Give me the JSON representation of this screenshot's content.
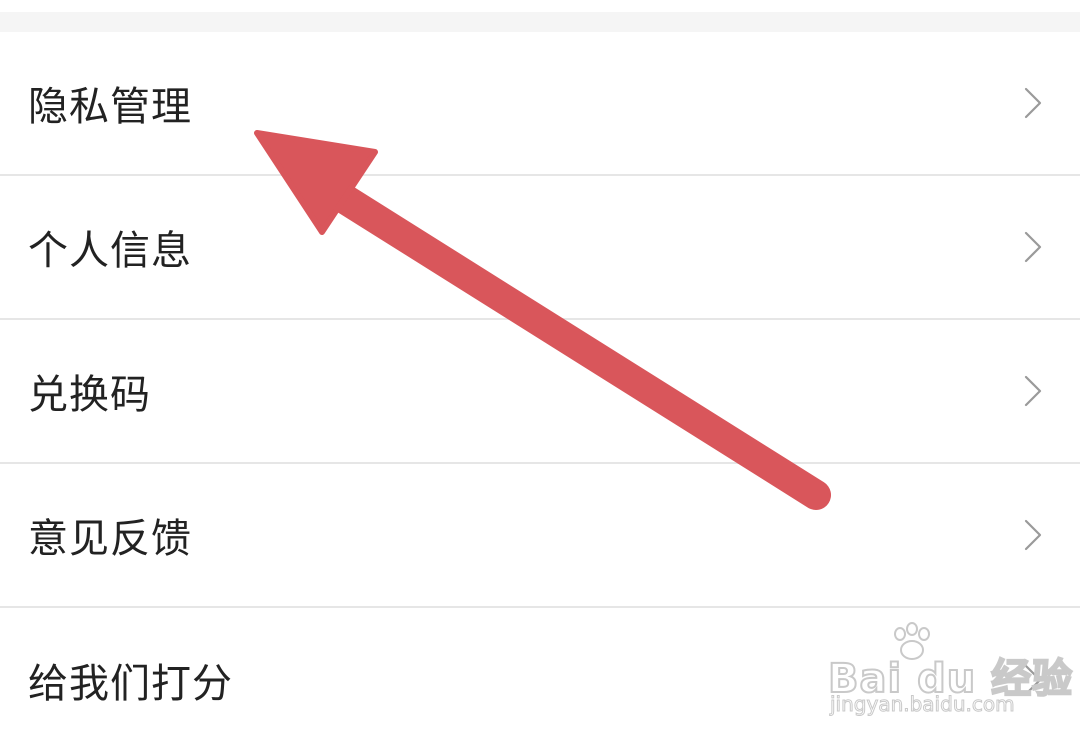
{
  "menu": {
    "items": [
      {
        "label": "隐私管理"
      },
      {
        "label": "个人信息"
      },
      {
        "label": "兑换码"
      },
      {
        "label": "意见反馈"
      },
      {
        "label": "给我们打分"
      }
    ]
  },
  "icons": {
    "chevron": "chevron-right-icon",
    "annotation": "annotation-arrow"
  },
  "watermark": {
    "brand": "Bai du 经验",
    "url": "jingyan.baidu.com"
  },
  "colors": {
    "arrow": "#d9565b",
    "divider": "#e6e6e6",
    "text": "#222222",
    "chevron": "#9a9a9a",
    "top_gap": "#f5f5f5"
  }
}
